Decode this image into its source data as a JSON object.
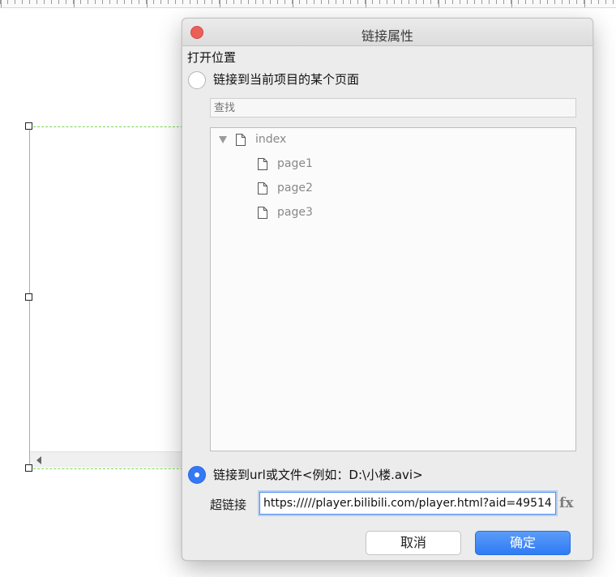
{
  "dialog": {
    "title": "链接属性",
    "section_title": "打开位置",
    "option_page": {
      "label": "链接到当前项目的某个页面",
      "selected": false
    },
    "search": {
      "placeholder": "查找"
    },
    "tree": [
      {
        "label": "index",
        "level": 0,
        "expanded": true
      },
      {
        "label": "page1",
        "level": 1
      },
      {
        "label": "page2",
        "level": 1
      },
      {
        "label": "page3",
        "level": 1
      }
    ],
    "option_url": {
      "label": "链接到url或文件<例如：D:\\小楼.avi>",
      "selected": true
    },
    "hyperlink": {
      "label": "超链接",
      "value": "https://///player.bilibili.com/player.html?aid=49514"
    },
    "fx_label": "fx",
    "cancel_label": "取消",
    "ok_label": "确定"
  },
  "colors": {
    "accent": "#3478f6",
    "close": "#ec5f57",
    "selection": "#7cd654"
  }
}
